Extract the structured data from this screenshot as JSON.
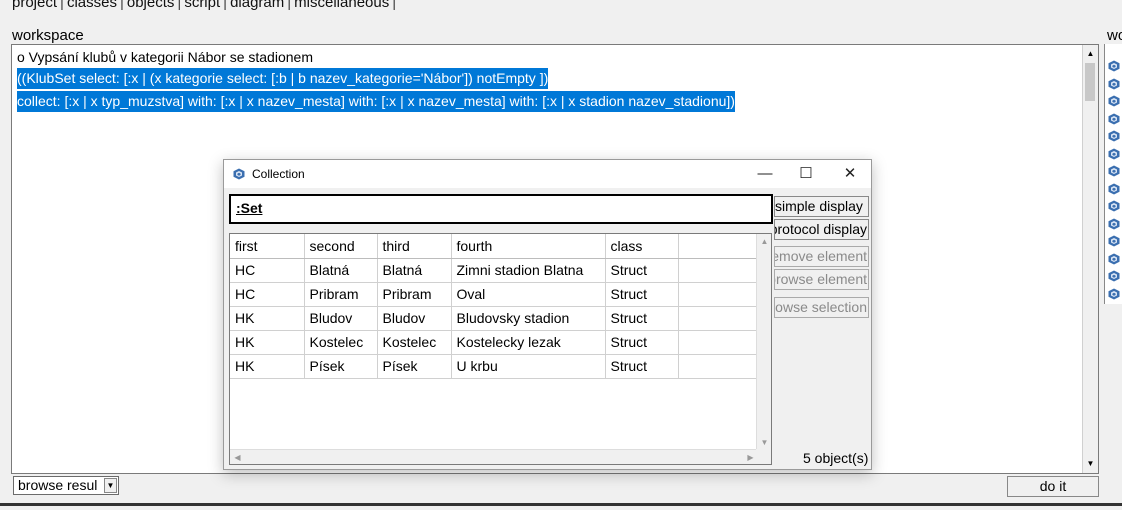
{
  "menu": {
    "items": [
      "project",
      "classes",
      "objects",
      "script",
      "diagram",
      "miscellaneous"
    ]
  },
  "workspace": {
    "label": "workspace",
    "right_label": "wo",
    "lines": [
      "o   Vypsání klubů v kategorii Nábor se stadionem",
      "((KlubSet select: [:x | (x kategorie select: [:b | b nazev_kategorie='Nábor']) notEmpty ])",
      "collect:  [:x | x typ_muzstva] with: [:x | x nazev_mesta] with: [:x | x nazev_mesta] with: [:x | x stadion nazev_stadionu])"
    ]
  },
  "bottom": {
    "browse_select_value": "browse resul",
    "do_it_label": "do it"
  },
  "dialog": {
    "title": "Collection",
    "set_label": ":Set",
    "columns": [
      "first",
      "second",
      "third",
      "fourth",
      "class"
    ],
    "rows": [
      [
        "HC",
        "Blatná",
        "Blatná",
        "Zimni stadion Blatna",
        "Struct"
      ],
      [
        "HC",
        "Pribram",
        "Pribram",
        "Oval",
        "Struct"
      ],
      [
        "HK",
        "Bludov",
        "Bludov",
        "Bludovsky stadion",
        "Struct"
      ],
      [
        "HK",
        "Kostelec",
        "Kostelec",
        "Kostelecky lezak",
        "Struct"
      ],
      [
        "HK",
        "Písek",
        "Písek",
        "U krbu",
        "Struct"
      ]
    ],
    "buttons": {
      "simple_display": "simple display",
      "protocol_display": "protocol display",
      "remove_element": "remove element",
      "browse_element": "browse element",
      "browse_selection": "browse selection"
    },
    "count_text": "5  object(s)",
    "window_controls": {
      "minimize": "—",
      "maximize": "☐",
      "close": "✕"
    }
  },
  "colors": {
    "selection": "#0078d7",
    "background": "#f0f0f0"
  },
  "icons": {
    "app": "cube-icon",
    "side_column": "cube-icon"
  }
}
